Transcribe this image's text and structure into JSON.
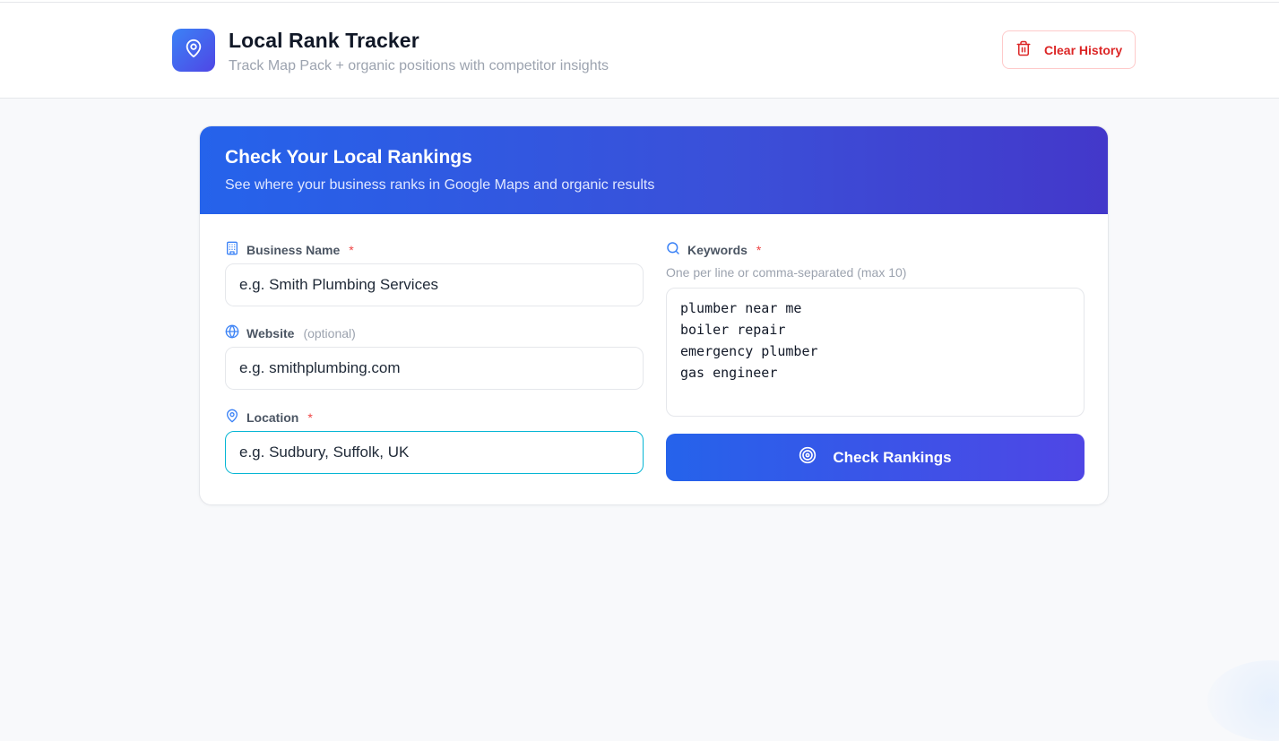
{
  "header": {
    "title": "Local Rank Tracker",
    "subtitle": "Track Map Pack + organic positions with competitor insights",
    "logo_icon": "map-pin-icon",
    "clear_button": {
      "label": "Clear History",
      "icon": "trash-icon"
    }
  },
  "card": {
    "title": "Check Your Local Rankings",
    "description": "See where your business ranks in Google Maps and organic results"
  },
  "form": {
    "business_name": {
      "label": "Business Name",
      "required_marker": "*",
      "placeholder": "e.g. Smith Plumbing Services",
      "icon": "building-icon"
    },
    "website": {
      "label": "Website",
      "optional_note": "(optional)",
      "placeholder": "e.g. smithplumbing.com",
      "icon": "globe-icon"
    },
    "location": {
      "label": "Location",
      "required_marker": "*",
      "placeholder": "e.g. Sudbury, Suffolk, UK",
      "icon": "map-pin-icon"
    },
    "keywords": {
      "label": "Keywords",
      "required_marker": "*",
      "hint": "One per line or comma-separated (max 10)",
      "value": "plumber near me\nboiler repair\nemergency plumber\ngas engineer",
      "icon": "search-icon"
    },
    "submit": {
      "label": "Check Rankings",
      "icon": "target-icon"
    }
  },
  "colors": {
    "accent": "#2563eb",
    "accent_end": "#4f46e5",
    "danger": "#dc2626",
    "focus_ring": "#06b6d4"
  }
}
